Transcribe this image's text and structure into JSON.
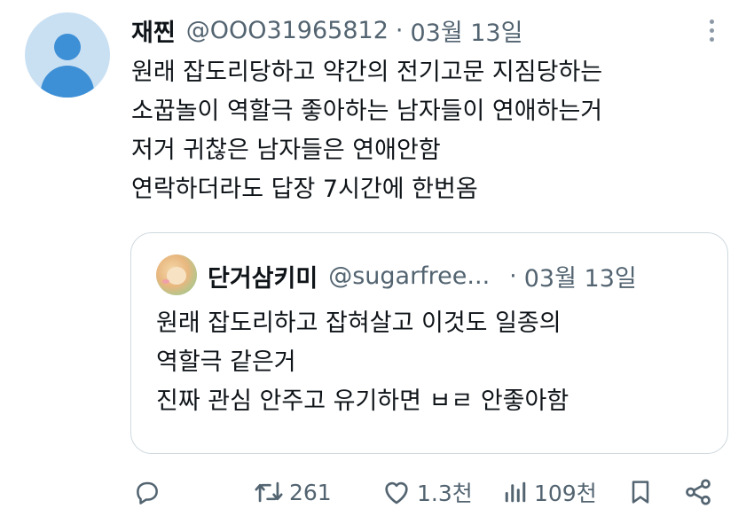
{
  "tweet": {
    "author_name": "재찐",
    "handle": "@OOO31965812",
    "separator": "·",
    "date": "03월 13일",
    "lines": [
      "원래 잡도리당하고 약간의 전기고문 지짐당하는",
      "소꿉놀이 역할극 좋아하는 남자들이 연애하는거",
      "저거 귀찮은 남자들은 연애안함",
      "연락하더라도 답장 7시간에 한번옴"
    ]
  },
  "quote": {
    "author_name": "단거삼키미",
    "handle": "@sugarfree...",
    "separator": "·",
    "date": "03월 13일",
    "lines": [
      "원래 잡도리하고 잡혀살고 이것도 일종의",
      "역할극 같은거",
      "진짜 관심 안주고 유기하면 ㅂㄹ 안좋아함"
    ]
  },
  "actions": {
    "reply": {
      "icon": "reply-icon",
      "count": ""
    },
    "retweet": {
      "icon": "retweet-icon",
      "count": "261"
    },
    "like": {
      "icon": "heart-icon",
      "count": "1.3천"
    },
    "views": {
      "icon": "views-icon",
      "count": "109천"
    },
    "bookmark": {
      "icon": "bookmark-icon"
    },
    "share": {
      "icon": "share-icon"
    }
  },
  "colors": {
    "text": "#0f1419",
    "secondary": "#536471",
    "border": "#cfd9de",
    "avatar_bg": "#c9e0f3",
    "avatar_fg": "#3d8fd6"
  }
}
